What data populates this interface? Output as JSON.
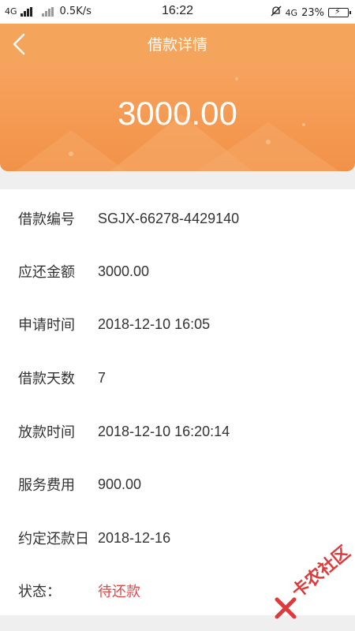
{
  "status_bar": {
    "network_left": "4G",
    "speed": "0.5K/s",
    "time": "16:22",
    "network_right": "4G",
    "battery": "23%"
  },
  "nav": {
    "title": "借款详情"
  },
  "banner": {
    "amount": "3000.00"
  },
  "details": [
    {
      "label": "借款编号",
      "value": "SGJX-66278-4429140"
    },
    {
      "label": "应还金额",
      "value": "3000.00"
    },
    {
      "label": "申请时间",
      "value": "2018-12-10 16:05"
    },
    {
      "label": "借款天数",
      "value": "7"
    },
    {
      "label": "放款时间",
      "value": "2018-12-10 16:20:14"
    },
    {
      "label": "服务费用",
      "value": "900.00"
    },
    {
      "label": "约定还款日",
      "value": "2018-12-16"
    },
    {
      "label": "状态：",
      "value": "待还款"
    }
  ],
  "watermark": {
    "text": "卡农社区"
  },
  "colors": {
    "accent": "#f4a45b",
    "status": "#d94c4c",
    "watermark": "#e0393b"
  }
}
